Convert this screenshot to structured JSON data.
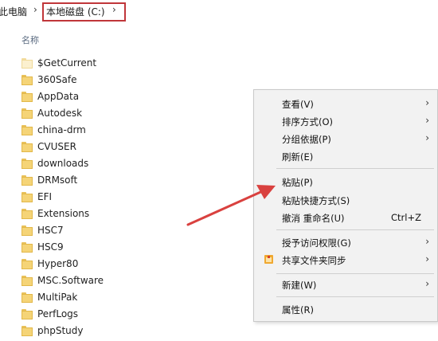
{
  "breadcrumb": {
    "parent": "此电脑",
    "current": "本地磁盘 (C:)",
    "separator": "›"
  },
  "columns": {
    "name_header": "名称"
  },
  "files": [
    {
      "name": "$GetCurrent",
      "icon": "folder-light-icon"
    },
    {
      "name": "360Safe",
      "icon": "folder-icon"
    },
    {
      "name": "AppData",
      "icon": "folder-icon"
    },
    {
      "name": "Autodesk",
      "icon": "folder-icon"
    },
    {
      "name": "china-drm",
      "icon": "folder-icon"
    },
    {
      "name": "CVUSER",
      "icon": "folder-icon"
    },
    {
      "name": "downloads",
      "icon": "folder-icon"
    },
    {
      "name": "DRMsoft",
      "icon": "folder-icon"
    },
    {
      "name": "EFI",
      "icon": "folder-icon"
    },
    {
      "name": "Extensions",
      "icon": "folder-icon"
    },
    {
      "name": "HSC7",
      "icon": "folder-icon"
    },
    {
      "name": "HSC9",
      "icon": "folder-icon"
    },
    {
      "name": "Hyper80",
      "icon": "folder-icon"
    },
    {
      "name": "MSC.Software",
      "icon": "folder-icon"
    },
    {
      "name": "MultiPak",
      "icon": "folder-icon"
    },
    {
      "name": "PerfLogs",
      "icon": "folder-icon"
    },
    {
      "name": "phpStudy",
      "icon": "folder-icon"
    }
  ],
  "context_menu": {
    "view": "查看(V)",
    "sort_by": "排序方式(O)",
    "group_by": "分组依据(P)",
    "refresh": "刷新(E)",
    "paste": "粘贴(P)",
    "paste_shortcut": "粘贴快捷方式(S)",
    "undo_rename": "撤消 重命名(U)",
    "undo_shortcut": "Ctrl+Z",
    "give_access": "授予访问权限(G)",
    "sync_shared": "共享文件夹同步",
    "new": "新建(W)",
    "properties": "属性(R)",
    "submenu_arrow": "›"
  },
  "colors": {
    "highlight_box": "#c0363a",
    "annotation_arrow": "#d9413f",
    "folder": "#f5d477"
  }
}
